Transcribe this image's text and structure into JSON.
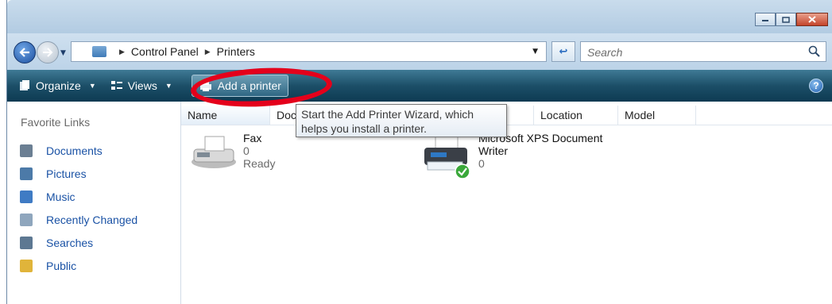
{
  "address": {
    "crumbs": [
      "Control Panel",
      "Printers"
    ]
  },
  "search": {
    "placeholder": "Search"
  },
  "toolbar": {
    "organize": "Organize",
    "views": "Views",
    "add_printer": "Add a printer"
  },
  "sidebar": {
    "title": "Favorite Links",
    "items": [
      {
        "label": "Documents",
        "icon": "documents-icon",
        "color": "#6b7f93"
      },
      {
        "label": "Pictures",
        "icon": "pictures-icon",
        "color": "#4c7aa8"
      },
      {
        "label": "Music",
        "icon": "music-icon",
        "color": "#3f7bc4"
      },
      {
        "label": "Recently Changed",
        "icon": "recently-changed-icon",
        "color": "#8fa6bd"
      },
      {
        "label": "Searches",
        "icon": "searches-icon",
        "color": "#5d7892"
      },
      {
        "label": "Public",
        "icon": "public-folder-icon",
        "color": "#e0b43a"
      }
    ]
  },
  "columns": {
    "name": "Name",
    "documents": "Docu",
    "status": "ts",
    "location": "Location",
    "model": "Model"
  },
  "tooltip": {
    "line1": "Start the Add Printer Wizard, which",
    "line2": "helps you install a printer."
  },
  "printers": [
    {
      "name": "Fax",
      "docs": "0",
      "status": "Ready"
    },
    {
      "name": "Microsoft XPS Document",
      "name2": "Writer",
      "docs": "0",
      "status": ""
    }
  ],
  "colors": {
    "toolbar_dark": "#0d3a52",
    "link_blue": "#1a52a5",
    "highlight_red": "#e4001b"
  }
}
